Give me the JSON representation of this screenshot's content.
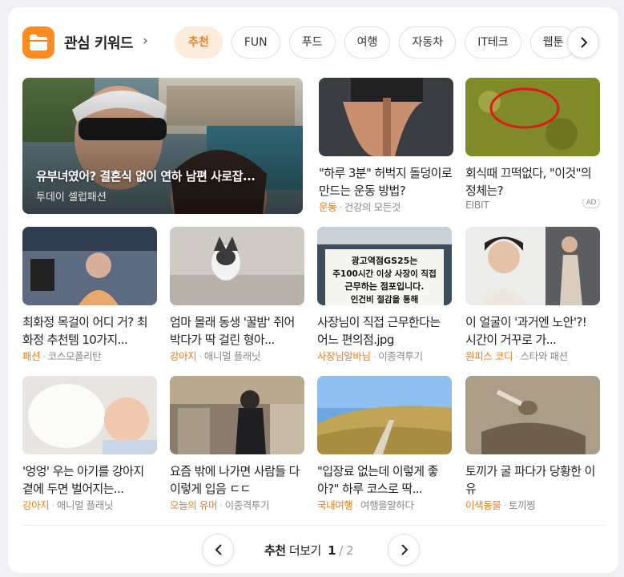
{
  "header": {
    "title": "관심 키워드",
    "chevron": "›"
  },
  "tabs": [
    "추천",
    "FUN",
    "푸드",
    "여행",
    "자동차",
    "IT테크",
    "웹툰"
  ],
  "feature": {
    "title": "유부녀였어? 결혼식 없이 연하 남편 사로잡...",
    "source": "투데이 셀럽패션"
  },
  "items": [
    {
      "title": "\"하루 3분\" 허벅지 돌덩이로 만드는 운동 방법?",
      "category": "운동",
      "source": "건강의 모든것"
    },
    {
      "title": "회식때 끄떡없다, \"이것\"의 정체는?",
      "category": "",
      "source": "EIBIT",
      "ad": "AD"
    },
    {
      "title": "최화정 목걸이 어디 거? 최화정 추천템 10가지...",
      "category": "패션",
      "source": "코스모폴리탄"
    },
    {
      "title": "엄마 몰래 동생 '꿀밤' 쥐어박다가 딱 걸린 형아...",
      "category": "강아지",
      "source": "애니멀 플래닛"
    },
    {
      "title": "사장님이 직접 근무한다는 어느 편의점.jpg",
      "category": "사장님알바님",
      "source": "이종격투기"
    },
    {
      "title": "이 얼굴이 '과거엔 노안'?! 시간이 거꾸로 가...",
      "category": "원피스 코디",
      "source": "스타와 패션"
    },
    {
      "title": "'엉엉' 우는 아기를 강아지 곁에 두면 벌어지는...",
      "category": "강아지",
      "source": "애니멀 플래닛"
    },
    {
      "title": "요즘 밖에 나가면 사람들 다 이렇게 입음 ㄷㄷ",
      "category": "오늘의 유머",
      "source": "이종격투기"
    },
    {
      "title": "\"입장료 없는데 이렇게 좋아?\" 하루 코스로 딱...",
      "category": "국내여행",
      "source": "여행을말하다"
    },
    {
      "title": "토끼가 굴 파다가 당황한 이유",
      "category": "이색동물",
      "source": "토끼찡"
    }
  ],
  "sign_text": [
    "광고역점GS25는",
    "주100시간 이상 사장이 직접",
    "근무하는 점포입니다.",
    "인건비 절감을 통해"
  ],
  "pager": {
    "label_a": "추천",
    "label_b": "더보기",
    "current": "1",
    "separator": "/",
    "total": "2"
  },
  "colors": {
    "accent": "#ef7d1d",
    "tab_active_bg": "#fdecdc",
    "folder": "#ff8a1f"
  },
  "icons": {
    "folder": "folder-icon",
    "next": "chevron-right-icon",
    "prev": "chevron-left-icon"
  }
}
